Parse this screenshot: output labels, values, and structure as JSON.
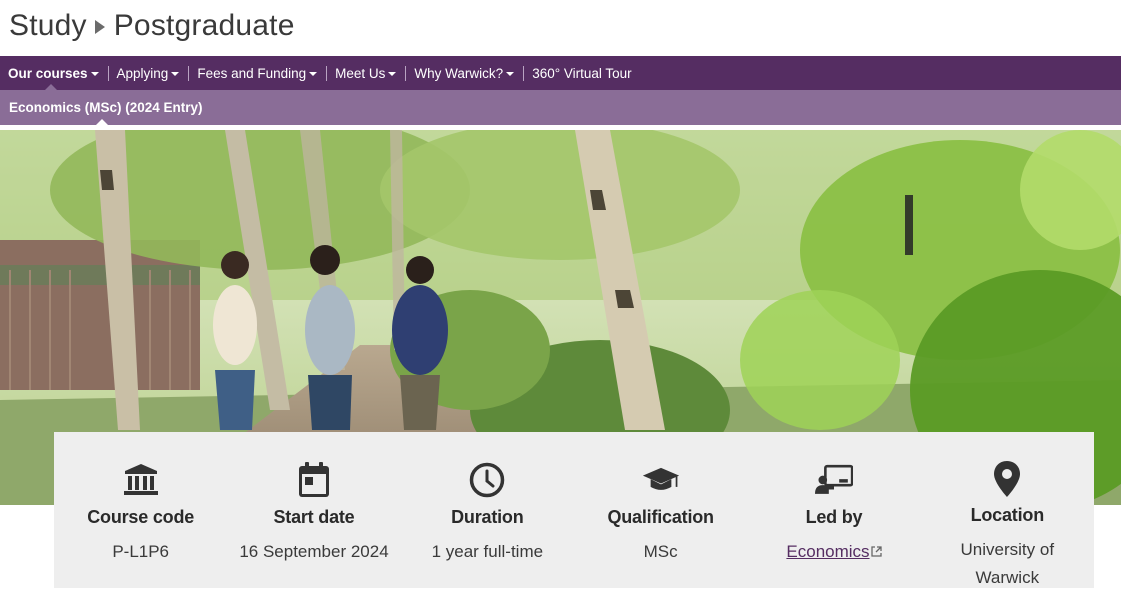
{
  "breadcrumb": {
    "items": [
      "Study",
      "Postgraduate"
    ]
  },
  "nav": {
    "items": [
      {
        "label": "Our courses",
        "dropdown": true
      },
      {
        "label": "Applying",
        "dropdown": true
      },
      {
        "label": "Fees and Funding",
        "dropdown": true
      },
      {
        "label": "Meet Us",
        "dropdown": true
      },
      {
        "label": "Why Warwick?",
        "dropdown": true
      },
      {
        "label": "360° Virtual Tour",
        "dropdown": false
      }
    ]
  },
  "subnav": {
    "label": "Economics (MSc) (2024 Entry)"
  },
  "hero": {
    "icon": "campus-photo",
    "description_hidden": true
  },
  "info": [
    {
      "icon": "building-columns-icon",
      "label": "Course code",
      "value": "P-L1P6"
    },
    {
      "icon": "calendar-icon",
      "label": "Start date",
      "value": "16 September 2024"
    },
    {
      "icon": "clock-icon",
      "label": "Duration",
      "value": "1 year full-time"
    },
    {
      "icon": "graduation-cap-icon",
      "label": "Qualification",
      "value": "MSc"
    },
    {
      "icon": "chalkboard-teacher-icon",
      "label": "Led by",
      "value": "Economics",
      "link": true
    },
    {
      "icon": "map-pin-icon",
      "label": "Location",
      "value": "University of Warwick"
    }
  ],
  "colors": {
    "nav": "#552d62",
    "subnav": "#8a6d97",
    "info_bg": "#eeeeee"
  }
}
